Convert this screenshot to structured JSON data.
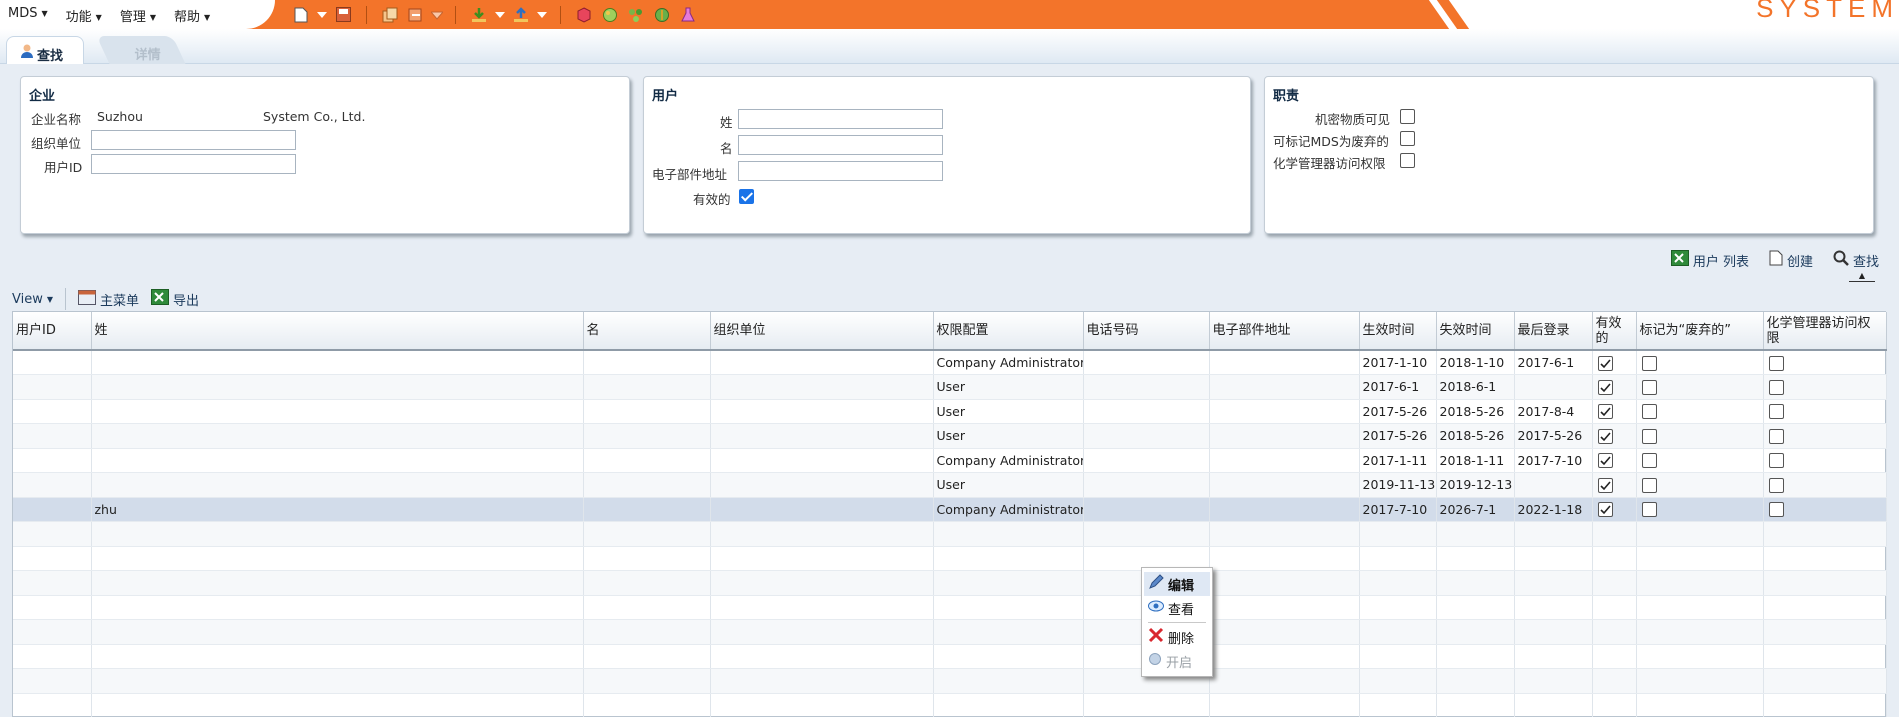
{
  "menu": {
    "items": [
      {
        "label": "MDS"
      },
      {
        "label": "功能"
      },
      {
        "label": "管理"
      },
      {
        "label": "帮助"
      }
    ]
  },
  "brand": {
    "text": "SYSTEM"
  },
  "tabs": {
    "find": "查找",
    "detail": "详情"
  },
  "panels": {
    "company": {
      "title": "企业",
      "name_label": "企业名称",
      "name_value_1": "Suzhou",
      "name_value_2": "System Co., Ltd.",
      "org_label": "组织单位",
      "userid_label": "用户ID"
    },
    "user": {
      "title": "用户",
      "lastname_label": "姓",
      "firstname_label": "名",
      "email_label": "电子部件地址",
      "active_label": "有效的",
      "active_checked": true
    },
    "duty": {
      "title": "职责",
      "secret_label": "机密物质可见",
      "deprecate_label": "可标记MDS为废弃的",
      "chem_label": "化学管理器访问权限"
    }
  },
  "actions": {
    "user_list": "用户 列表",
    "create": "创建",
    "find": "查找"
  },
  "gridbar": {
    "view": "View",
    "main_menu": "主菜单",
    "export": "导出"
  },
  "table": {
    "headers": {
      "userid": "用户ID",
      "lastname": "姓",
      "firstname": "名",
      "org": "组织单位",
      "role": "权限配置",
      "phone": "电话号码",
      "email": "电子部件地址",
      "start": "生效时间",
      "end": "失效时间",
      "last": "最后登录",
      "active": "有效的",
      "deprecated": "标记为“废弃的”",
      "chem": "化学管理器访问权限"
    },
    "rows": [
      {
        "lastname": "",
        "role": "Company Administrator",
        "start": "2017-1-10",
        "end": "2018-1-10",
        "last": "2017-6-1",
        "active": true,
        "deprecated": false,
        "chem": false
      },
      {
        "lastname": "",
        "role": "User",
        "start": "2017-6-1",
        "end": "2018-6-1",
        "last": "",
        "active": true,
        "deprecated": false,
        "chem": false
      },
      {
        "lastname": "",
        "role": "User",
        "start": "2017-5-26",
        "end": "2018-5-26",
        "last": "2017-8-4",
        "active": true,
        "deprecated": false,
        "chem": false
      },
      {
        "lastname": "",
        "role": "User",
        "start": "2017-5-26",
        "end": "2018-5-26",
        "last": "2017-5-26",
        "active": true,
        "deprecated": false,
        "chem": false
      },
      {
        "lastname": "",
        "role": "Company Administrator",
        "start": "2017-1-11",
        "end": "2018-1-11",
        "last": "2017-7-10",
        "active": true,
        "deprecated": false,
        "chem": false
      },
      {
        "lastname": "",
        "role": "User",
        "start": "2019-11-13",
        "end": "2019-12-13",
        "last": "",
        "active": true,
        "deprecated": false,
        "chem": false
      },
      {
        "lastname": "zhu",
        "role": "Company Administrator",
        "start": "2017-7-10",
        "end": "2026-7-1",
        "last": "2022-1-18",
        "active": true,
        "deprecated": false,
        "chem": false
      }
    ]
  },
  "context_menu": {
    "edit": "编辑",
    "view": "查看",
    "delete": "删除",
    "open": "开启"
  },
  "colors": {
    "accent": "#f3742a",
    "selected_row": "#d2dcea",
    "panel_bg": "#e7edf4",
    "check_blue": "#1a73e8"
  }
}
